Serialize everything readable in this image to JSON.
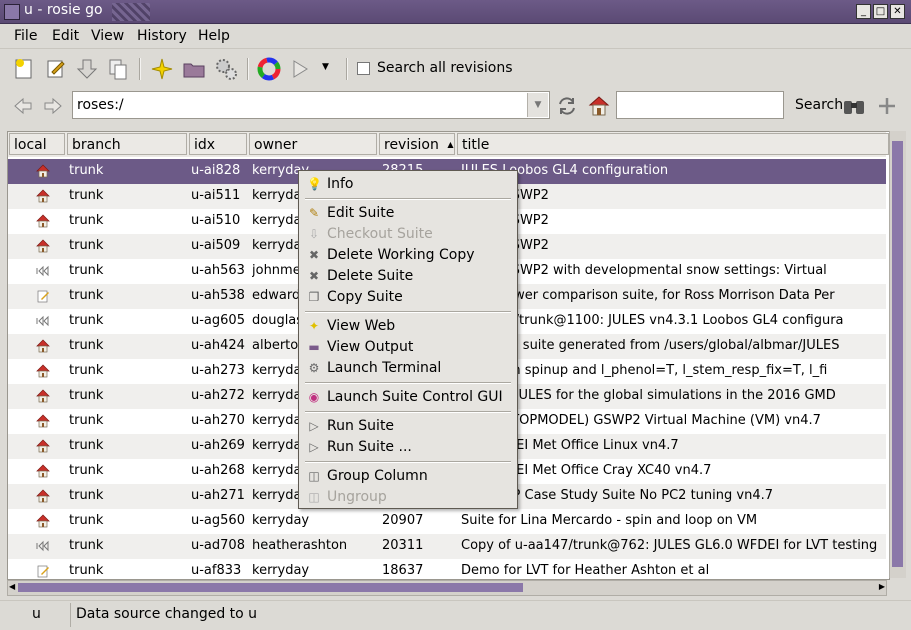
{
  "window": {
    "title": "u - rosie go"
  },
  "menubar": [
    "File",
    "Edit",
    "View",
    "History",
    "Help"
  ],
  "toolbar": {
    "search_all_label": "Search all revisions"
  },
  "nav": {
    "address_value": "roses:/",
    "search_value": "",
    "search_label": "Search"
  },
  "table": {
    "columns": [
      "local",
      "branch",
      "idx",
      "owner",
      "revision",
      "title"
    ],
    "sort_indicator": "▲",
    "rows": [
      {
        "branch": "trunk",
        "idx": "u-ai828",
        "owner": "kerryday",
        "revision": "28215",
        "title": "JULES Loobos GL4 configuration",
        "local": "home",
        "selected": true
      },
      {
        "branch": "trunk",
        "idx": "u-ai511",
        "owner": "kerryda",
        "revision": "",
        "title": "ain of GSWP2",
        "local": "home"
      },
      {
        "branch": "trunk",
        "idx": "u-ai510",
        "owner": "kerryda",
        "revision": "",
        "title": "ain of GSWP2",
        "local": "home"
      },
      {
        "branch": "trunk",
        "idx": "u-ai509",
        "owner": "kerryda",
        "revision": "",
        "title": "ain of GSWP2",
        "local": "home"
      },
      {
        "branch": "trunk",
        "idx": "u-ah563",
        "owner": "johnme",
        "revision": "",
        "title": "ain of GSWP2 with developmental snow settings: Virtual",
        "local": "rewind"
      },
      {
        "branch": "trunk",
        "idx": "u-ah538",
        "owner": "edward",
        "revision": "",
        "title": "y flux tower comparison suite, for Ross Morrison Data Per",
        "local": "edit"
      },
      {
        "branch": "trunk",
        "idx": "u-ag605",
        "owner": "douglas",
        "revision": "",
        "title": "u-aa349/trunk@1100: JULES vn4.3.1 Loobos GL4 configura",
        "local": "rewind"
      },
      {
        "branch": "trunk",
        "idx": "u-ah424",
        "owner": "alberto",
        "revision": "",
        "title": "eate app suite generated from /users/global/albmar/JULES",
        "local": "home"
      },
      {
        "branch": "trunk",
        "idx": "u-ah273",
        "owner": "kerryda",
        "revision": "",
        "title": "L6.0 with spinup and l_phenol=T, l_stem_resp_fix=T, l_fi",
        "local": "home"
      },
      {
        "branch": "trunk",
        "idx": "u-ah272",
        "owner": "kerryda",
        "revision": "",
        "title": "ation of JULES for the global simulations in the 2016 GMD",
        "local": "home"
      },
      {
        "branch": "trunk",
        "idx": "u-ah270",
        "owner": "kerryda",
        "revision": "",
        "title": "6.0 (no TOPMODEL) GSWP2 Virtual Machine (VM) vn4.7",
        "local": "home"
      },
      {
        "branch": "trunk",
        "idx": "u-ah269",
        "owner": "kerryda",
        "revision": "",
        "title": "6.0 WFDEI Met Office Linux vn4.7",
        "local": "home"
      },
      {
        "branch": "trunk",
        "idx": "u-ah268",
        "owner": "kerryda",
        "revision": "",
        "title": "6.0 WFDEI Met Office Cray XC40 vn4.7",
        "local": "home"
      },
      {
        "branch": "trunk",
        "idx": "u-ah271",
        "owner": "kerryda",
        "revision": "",
        "title": "320 NWP Case Study Suite No PC2 tuning vn4.7",
        "local": "home"
      },
      {
        "branch": "trunk",
        "idx": "u-ag560",
        "owner": "kerryday",
        "revision": "20907",
        "title": "Suite for Lina Mercardo - spin and loop on VM",
        "local": "home"
      },
      {
        "branch": "trunk",
        "idx": "u-ad708",
        "owner": "heatherashton",
        "revision": "20311",
        "title": "Copy of u-aa147/trunk@762: JULES GL6.0 WFDEI for LVT testing",
        "local": "rewind"
      },
      {
        "branch": "trunk",
        "idx": "u-af833",
        "owner": "kerryday",
        "revision": "18637",
        "title": "Demo for LVT for Heather Ashton et al",
        "local": "edit"
      }
    ]
  },
  "context_menu": [
    {
      "label": "Info",
      "icon": "info-icon",
      "enabled": true
    },
    {
      "sep": true
    },
    {
      "label": "Edit Suite",
      "icon": "edit-icon",
      "enabled": true
    },
    {
      "label": "Checkout Suite",
      "icon": "checkout-icon",
      "enabled": false
    },
    {
      "label": "Delete Working Copy",
      "icon": "delete-icon",
      "enabled": true
    },
    {
      "label": "Delete Suite",
      "icon": "delete-icon",
      "enabled": true
    },
    {
      "label": "Copy Suite",
      "icon": "copy-icon",
      "enabled": true
    },
    {
      "sep": true
    },
    {
      "label": "View Web",
      "icon": "star-icon",
      "enabled": true
    },
    {
      "label": "View Output",
      "icon": "folder-icon",
      "enabled": true
    },
    {
      "label": "Launch Terminal",
      "icon": "terminal-icon",
      "enabled": true
    },
    {
      "sep": true
    },
    {
      "label": "Launch Suite Control GUI",
      "icon": "colorwheel-icon",
      "enabled": true
    },
    {
      "sep": true
    },
    {
      "label": "Run Suite",
      "icon": "play-icon",
      "enabled": true
    },
    {
      "label": "Run Suite ...",
      "icon": "play-icon",
      "enabled": true
    },
    {
      "sep": true
    },
    {
      "label": "Group Column",
      "icon": "group-icon",
      "enabled": true
    },
    {
      "label": "Ungroup",
      "icon": "ungroup-icon",
      "enabled": false
    }
  ],
  "status": {
    "prefix": "u",
    "message": "Data source changed to u"
  },
  "colors": {
    "titlebar": "#6c5a87",
    "selection": "#6c5a87",
    "scroll_thumb": "#8b78a9"
  }
}
